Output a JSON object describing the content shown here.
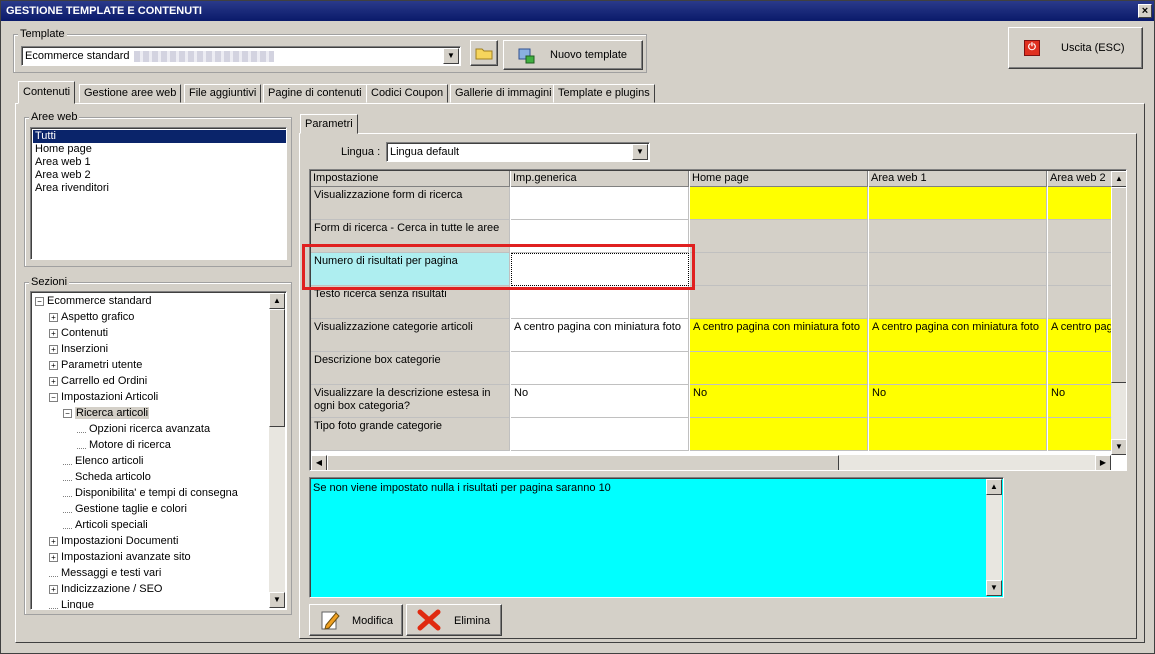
{
  "window": {
    "title": "GESTIONE TEMPLATE E CONTENUTI",
    "close_glyph": "×"
  },
  "template": {
    "legend": "Template",
    "selected": "Ecommerce standard",
    "new_button": "Nuovo template",
    "exit_button": "Uscita (ESC)"
  },
  "tabs": [
    "Contenuti",
    "Gestione aree web",
    "File aggiuntivi",
    "Pagine di contenuti",
    "Codici Coupon",
    "Gallerie di immagini",
    "Template e plugins"
  ],
  "aree_web": {
    "legend": "Aree web",
    "items": [
      "Tutti",
      "Home page",
      "Area web 1",
      "Area web 2",
      "Area rivenditori"
    ],
    "selected_index": 0
  },
  "sezioni": {
    "legend": "Sezioni",
    "items": [
      {
        "label": "Ecommerce standard",
        "level": 0,
        "exp": "−"
      },
      {
        "label": "Aspetto grafico",
        "level": 1,
        "exp": "+"
      },
      {
        "label": "Contenuti",
        "level": 1,
        "exp": "+"
      },
      {
        "label": "Inserzioni",
        "level": 1,
        "exp": "+"
      },
      {
        "label": "Parametri utente",
        "level": 1,
        "exp": "+"
      },
      {
        "label": "Carrello ed Ordini",
        "level": 1,
        "exp": "+"
      },
      {
        "label": "Impostazioni Articoli",
        "level": 1,
        "exp": "−"
      },
      {
        "label": "Ricerca articoli",
        "level": 2,
        "exp": "−",
        "selected": true
      },
      {
        "label": "Opzioni ricerca avanzata",
        "level": 3,
        "exp": ""
      },
      {
        "label": "Motore di ricerca",
        "level": 3,
        "exp": ""
      },
      {
        "label": "Elenco articoli",
        "level": 2,
        "exp": ""
      },
      {
        "label": "Scheda articolo",
        "level": 2,
        "exp": ""
      },
      {
        "label": "Disponibilita' e tempi di consegna",
        "level": 2,
        "exp": ""
      },
      {
        "label": "Gestione taglie e colori",
        "level": 2,
        "exp": ""
      },
      {
        "label": "Articoli speciali",
        "level": 2,
        "exp": ""
      },
      {
        "label": "Impostazioni Documenti",
        "level": 1,
        "exp": "+"
      },
      {
        "label": "Impostazioni avanzate sito",
        "level": 1,
        "exp": "+"
      },
      {
        "label": "Messaggi e testi vari",
        "level": 1,
        "exp": ""
      },
      {
        "label": "Indicizzazione / SEO",
        "level": 1,
        "exp": "+"
      },
      {
        "label": "Lingue",
        "level": 1,
        "exp": ""
      }
    ]
  },
  "parametri": {
    "tab": "Parametri",
    "lingua_label": "Lingua :",
    "lingua_value": "Lingua default"
  },
  "grid": {
    "columns": [
      "Impostazione",
      "Imp.generica",
      "Home page",
      "Area web 1",
      "Area web 2"
    ],
    "rows": [
      {
        "label": "Visualizzazione form di ricerca",
        "values": [
          "",
          "",
          "",
          ""
        ],
        "kinds": [
          "w",
          "y",
          "y",
          "y"
        ]
      },
      {
        "label": "Form di ricerca - Cerca in tutte le aree",
        "values": [
          "",
          "",
          "",
          ""
        ],
        "kinds": [
          "w",
          "g",
          "g",
          "g"
        ]
      },
      {
        "label": "Numero di risultati per pagina",
        "values": [
          "",
          "",
          "",
          ""
        ],
        "kinds": [
          "w",
          "g",
          "g",
          "g"
        ]
      },
      {
        "label": "Testo ricerca senza risultati",
        "values": [
          "",
          "",
          "",
          ""
        ],
        "kinds": [
          "w",
          "g",
          "g",
          "g"
        ]
      },
      {
        "label": "Visualizzazione categorie articoli",
        "values": [
          "A centro pagina con miniatura foto",
          "A centro pagina con miniatura foto",
          "A centro pagina con miniatura foto",
          "A centro pagina con miniatura foto"
        ],
        "kinds": [
          "w",
          "y",
          "y",
          "y"
        ]
      },
      {
        "label": "Descrizione box categorie",
        "values": [
          "",
          "",
          "",
          ""
        ],
        "kinds": [
          "w",
          "y",
          "y",
          "y"
        ]
      },
      {
        "label": "Visualizzare la descrizione estesa in ogni box categoria?",
        "values": [
          "No",
          "No",
          "No",
          "No"
        ],
        "kinds": [
          "w",
          "y",
          "y",
          "y"
        ]
      },
      {
        "label": "Tipo foto grande categorie",
        "values": [
          "",
          "",
          "",
          ""
        ],
        "kinds": [
          "w",
          "y",
          "y",
          "y"
        ]
      }
    ],
    "selected_row": 2
  },
  "description": "Se non viene impostato nulla i risultati per pagina saranno 10",
  "buttons": {
    "modifica": "Modifica",
    "elimina": "Elimina"
  },
  "colors": {
    "highlight_box": "#e02020",
    "description_bg": "#00ffff",
    "selected_label_bg": "#aeeef0"
  }
}
